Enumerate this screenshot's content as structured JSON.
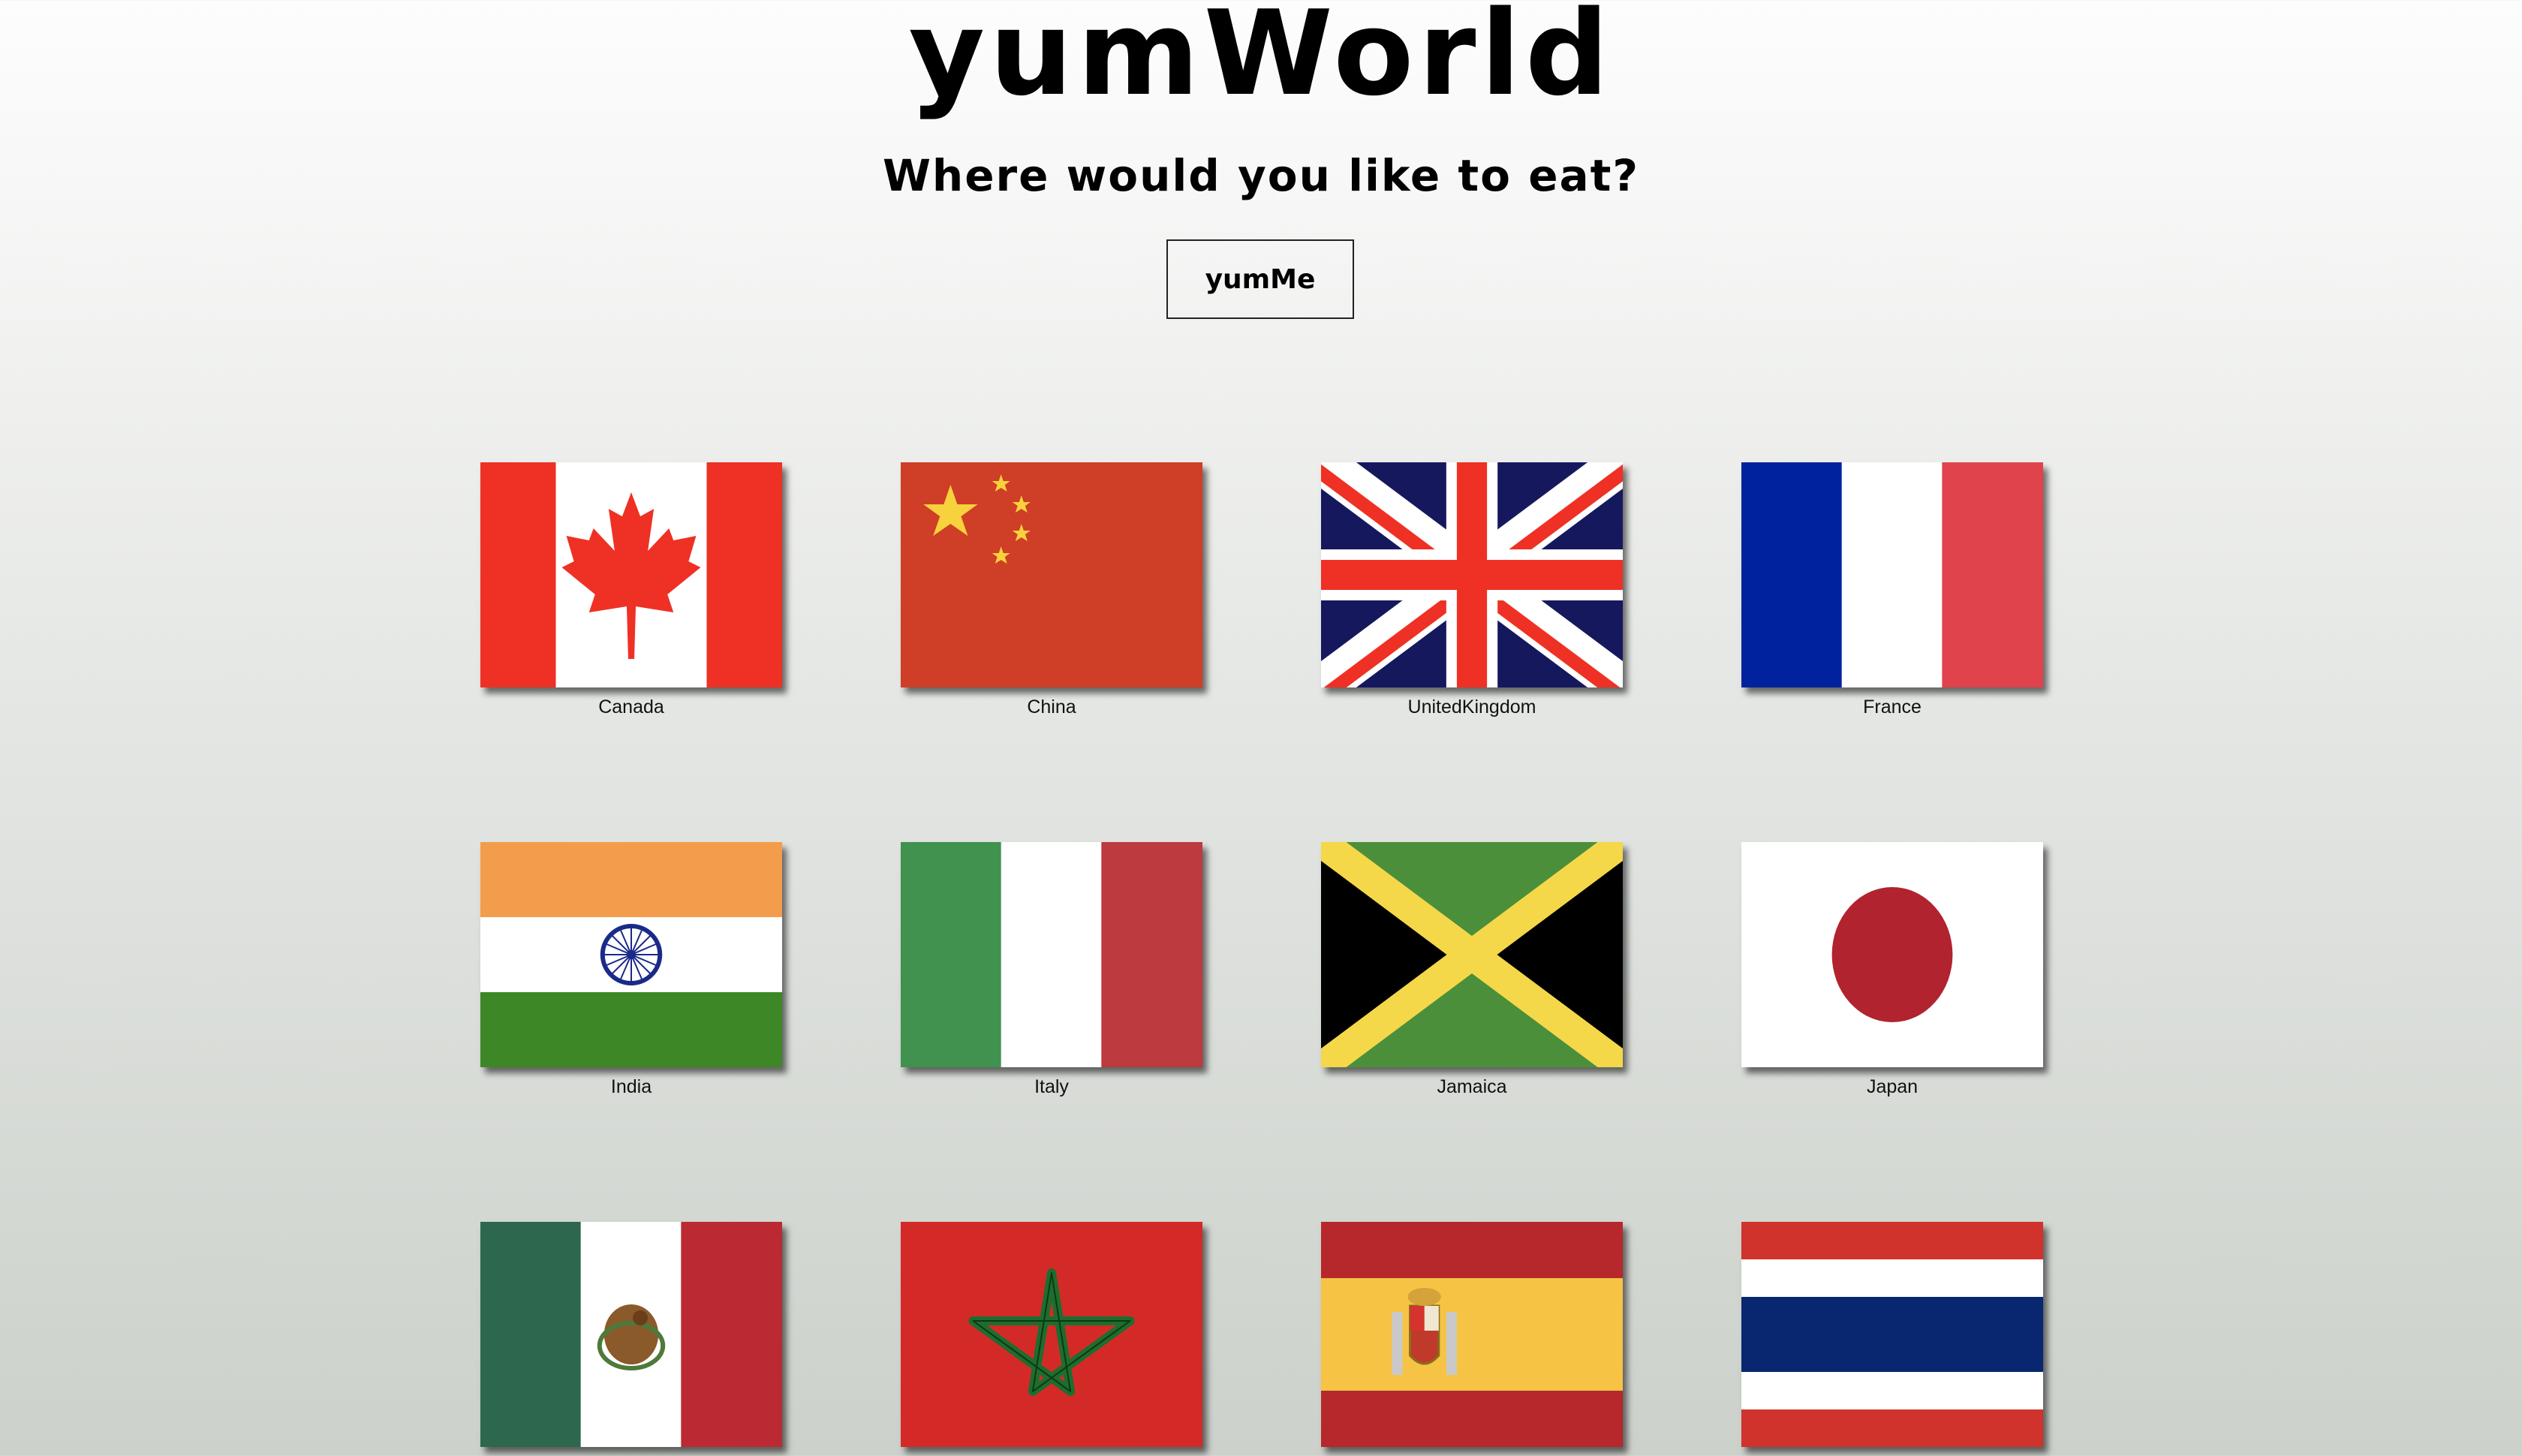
{
  "header": {
    "title": "yumWorld",
    "subtitle": "Where would you like to eat?",
    "button_label": "yumMe"
  },
  "countries": [
    {
      "name": "Canada",
      "flag_icon": "canada-flag-icon"
    },
    {
      "name": "China",
      "flag_icon": "china-flag-icon"
    },
    {
      "name": "UnitedKingdom",
      "flag_icon": "united-kingdom-flag-icon"
    },
    {
      "name": "France",
      "flag_icon": "france-flag-icon"
    },
    {
      "name": "India",
      "flag_icon": "india-flag-icon"
    },
    {
      "name": "Italy",
      "flag_icon": "italy-flag-icon"
    },
    {
      "name": "Jamaica",
      "flag_icon": "jamaica-flag-icon"
    },
    {
      "name": "Japan",
      "flag_icon": "japan-flag-icon"
    },
    {
      "name": "",
      "flag_icon": "mexico-flag-icon"
    },
    {
      "name": "",
      "flag_icon": "morocco-flag-icon"
    },
    {
      "name": "",
      "flag_icon": "spain-flag-icon"
    },
    {
      "name": "",
      "flag_icon": "thailand-flag-icon"
    }
  ]
}
